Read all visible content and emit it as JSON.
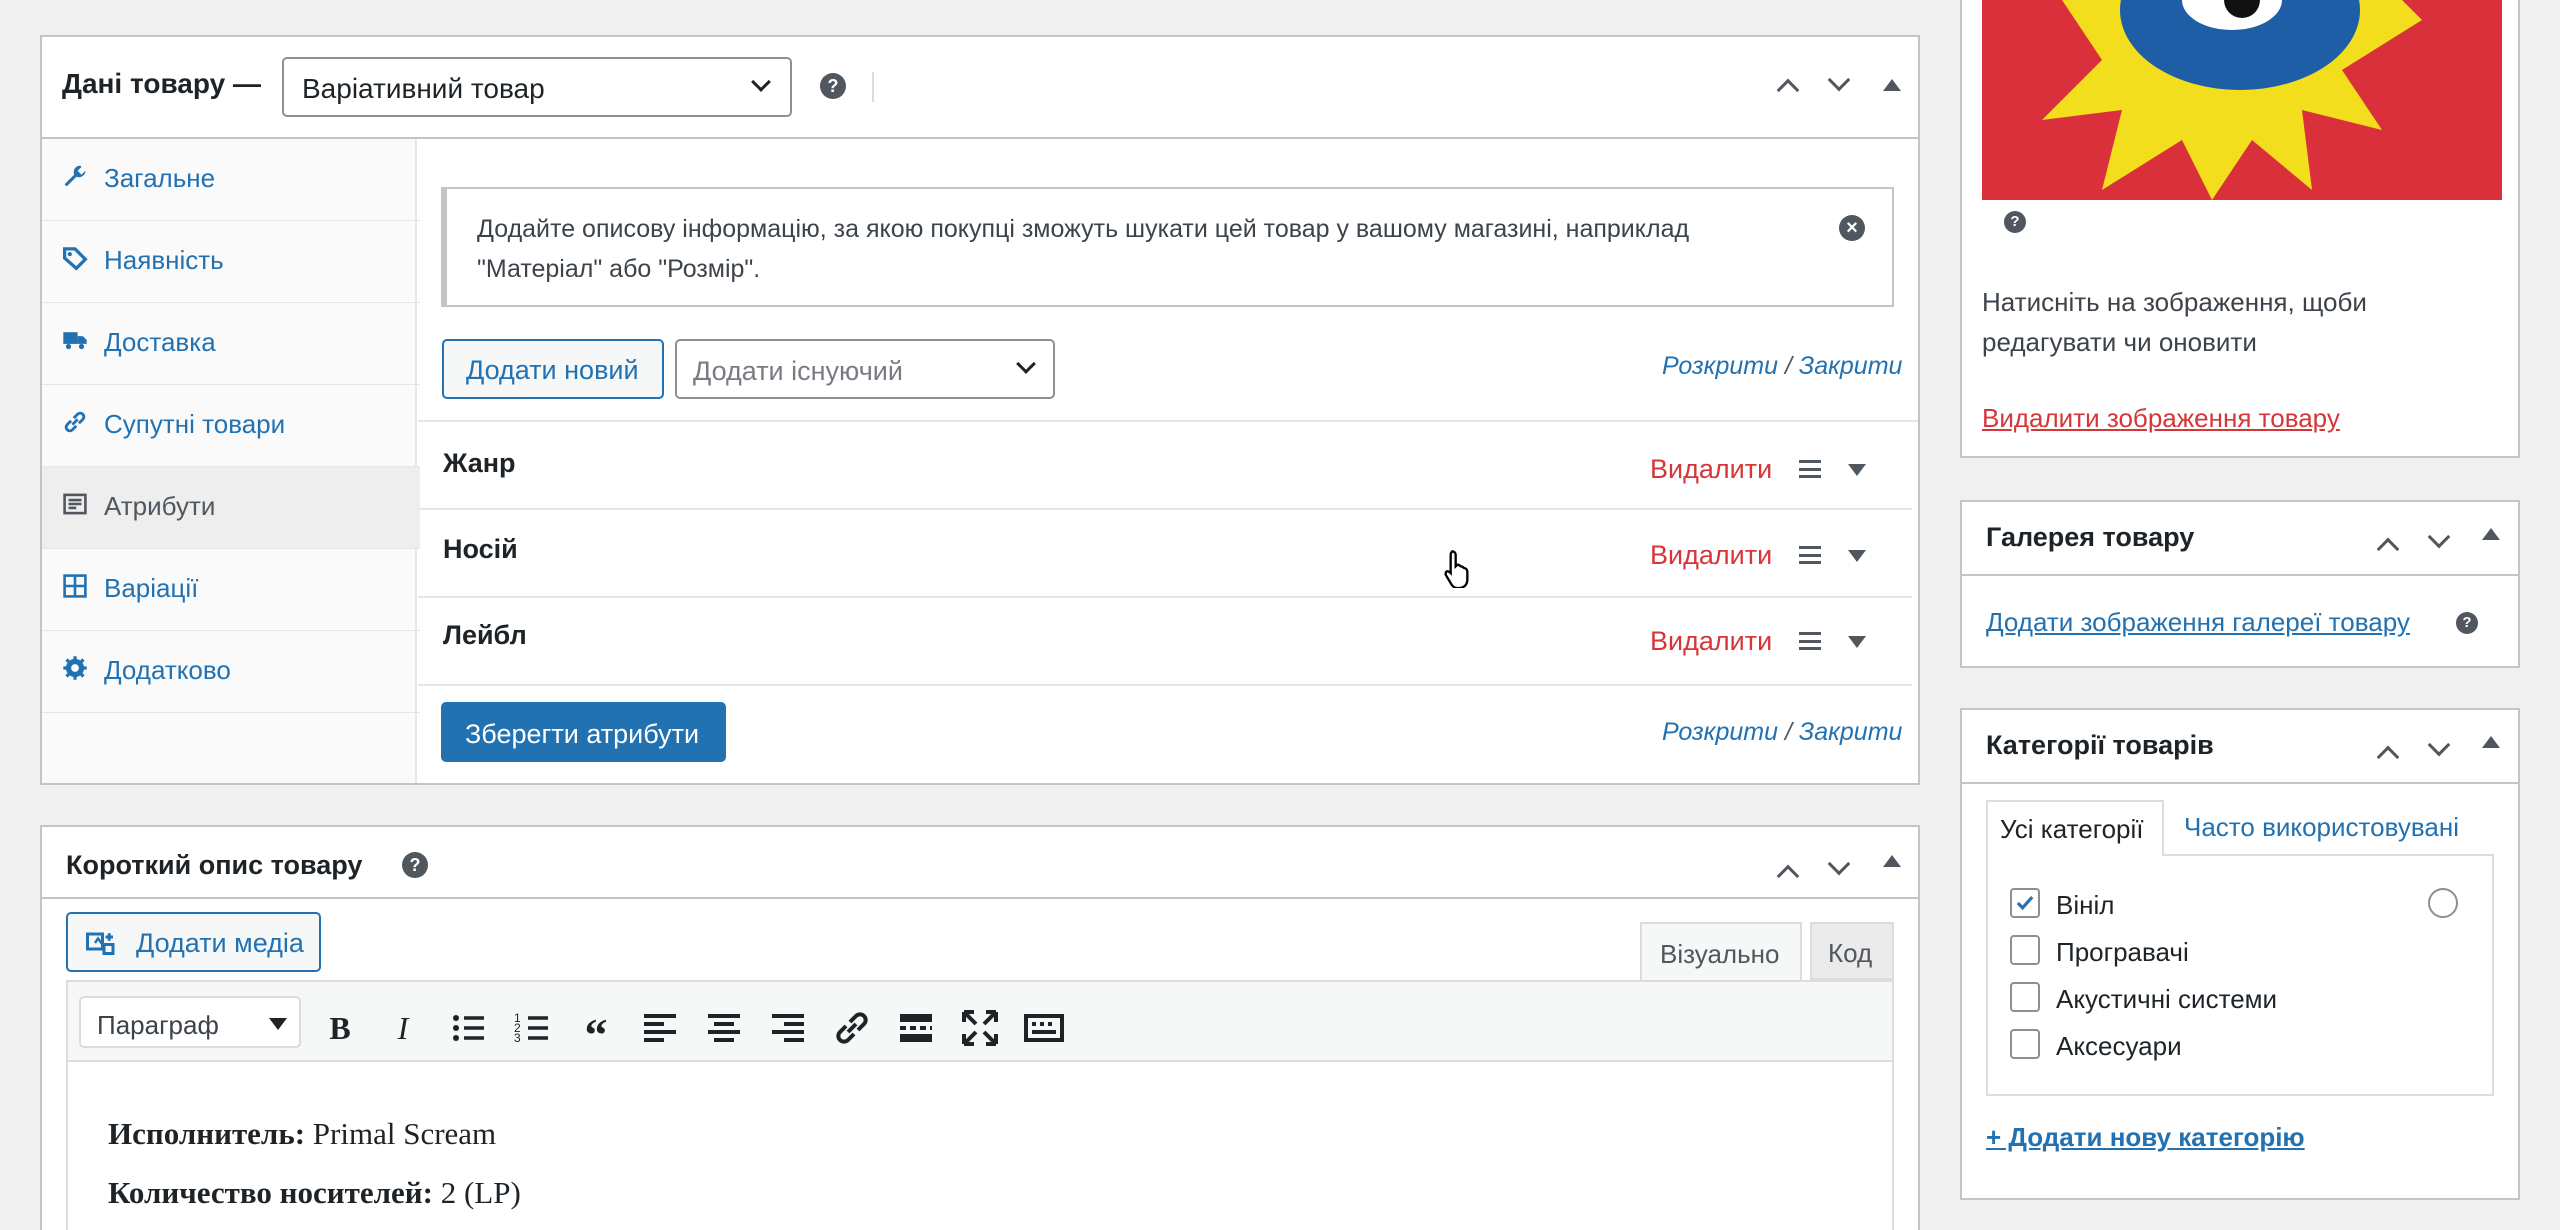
{
  "product_data": {
    "title": "Дані товару —",
    "product_type": "Варіативний товар",
    "tabs": [
      {
        "label": "Загальне",
        "icon": "wrench-icon"
      },
      {
        "label": "Наявність",
        "icon": "tag-icon"
      },
      {
        "label": "Доставка",
        "icon": "truck-icon"
      },
      {
        "label": "Супутні товари",
        "icon": "link-icon"
      },
      {
        "label": "Атрибути",
        "icon": "list-icon"
      },
      {
        "label": "Варіації",
        "icon": "grid-icon"
      },
      {
        "label": "Додатково",
        "icon": "gear-icon"
      }
    ],
    "notice": "Додайте описову інформацію, за якою покупці зможуть шукати цей товар у вашому магазині, наприклад \"Матеріал\" або \"Розмір\".",
    "add_new_label": "Додати новий",
    "add_existing_placeholder": "Додати існуючий",
    "expand_label": "Розкрити",
    "separator": "/",
    "close_label": "Закрити",
    "attributes": [
      {
        "name": "Жанр",
        "remove": "Видалити"
      },
      {
        "name": "Носій",
        "remove": "Видалити"
      },
      {
        "name": "Лейбл",
        "remove": "Видалити"
      }
    ],
    "save_label": "Зберегти атрибути"
  },
  "short_desc": {
    "title": "Короткий опис товару",
    "add_media": "Додати медіа",
    "tab_visual": "Візуально",
    "tab_code": "Код",
    "format": "Параграф",
    "lines": [
      {
        "label": "Исполнитель:",
        "value": "Primal Scream"
      },
      {
        "label": "Количество носителей:",
        "value": "2 (LP)"
      }
    ]
  },
  "image_box": {
    "help_text": "Натисніть на зображення, щоби редагувати чи оновити",
    "remove_label": "Видалити зображення товару"
  },
  "gallery": {
    "title": "Галерея товару",
    "add_label": "Додати зображення галереї товару"
  },
  "categories": {
    "title": "Категорії товарів",
    "tab_all": "Усі категорії",
    "tab_popular": "Часто використовувані",
    "items": [
      {
        "label": "Вініл",
        "checked": true
      },
      {
        "label": "Програвачі",
        "checked": false
      },
      {
        "label": "Акустичні системи",
        "checked": false
      },
      {
        "label": "Аксесуари",
        "checked": false
      }
    ],
    "add_new": "+ Додати нову категорію"
  },
  "colors": {
    "accent": "#2271b1",
    "danger": "#d63638",
    "border": "#c3c4c7"
  }
}
